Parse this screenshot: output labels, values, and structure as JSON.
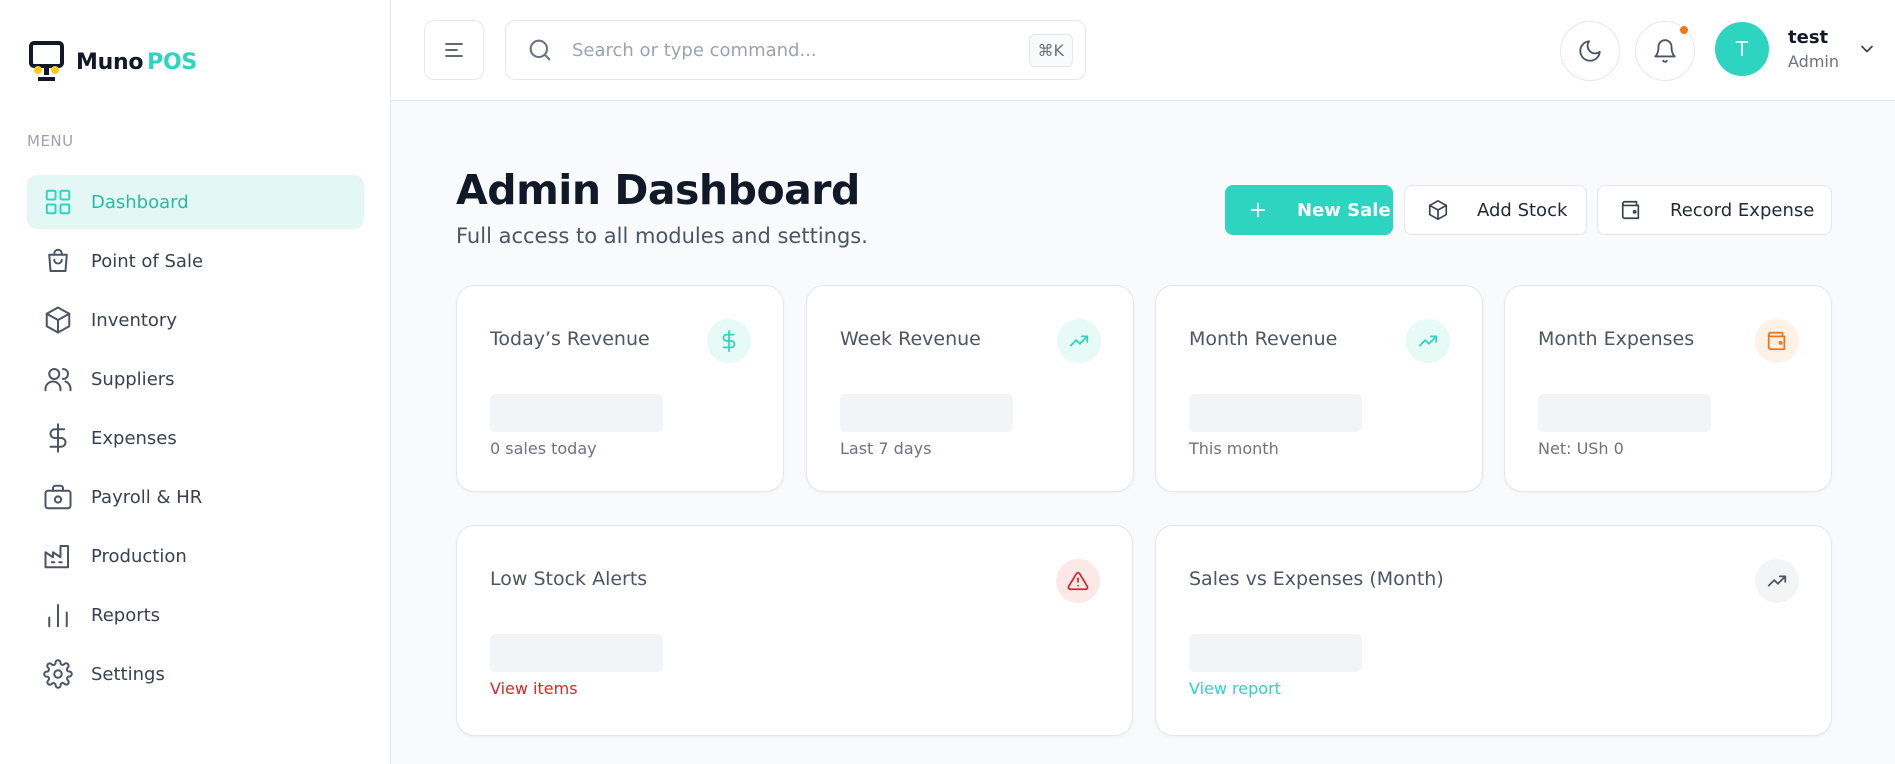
{
  "brand": {
    "name": "Muno",
    "accent": "POS"
  },
  "sidebar": {
    "menu_label": "MENU",
    "items": [
      {
        "label": "Dashboard",
        "icon": "grid-icon",
        "active": true
      },
      {
        "label": "Point of Sale",
        "icon": "shopping-bag-icon"
      },
      {
        "label": "Inventory",
        "icon": "box-icon"
      },
      {
        "label": "Suppliers",
        "icon": "users-icon"
      },
      {
        "label": "Expenses",
        "icon": "dollar-icon"
      },
      {
        "label": "Payroll & HR",
        "icon": "briefcase-icon"
      },
      {
        "label": "Production",
        "icon": "factory-icon"
      },
      {
        "label": "Reports",
        "icon": "bar-chart-icon"
      },
      {
        "label": "Settings",
        "icon": "gear-icon"
      }
    ]
  },
  "topbar": {
    "search_placeholder": "Search or type command...",
    "shortcut": "⌘K",
    "user": {
      "initial": "T",
      "name": "test",
      "role": "Admin"
    }
  },
  "page": {
    "title": "Admin Dashboard",
    "subtitle": "Full access to all modules and settings.",
    "actions": {
      "new_sale": "New Sale",
      "add_stock": "Add Stock",
      "record_expense": "Record Expense"
    }
  },
  "stats": [
    {
      "title": "Today’s Revenue",
      "sub": "0 sales today",
      "icon": "dollar-icon"
    },
    {
      "title": "Week Revenue",
      "sub": "Last 7 days",
      "icon": "trending-up-icon"
    },
    {
      "title": "Month Revenue",
      "sub": "This month",
      "icon": "trending-up-icon"
    },
    {
      "title": "Month Expenses",
      "sub": "Net: USh 0",
      "icon": "wallet-icon"
    }
  ],
  "panels": {
    "low_stock": {
      "title": "Low Stock Alerts",
      "link": "View items",
      "icon": "alert-triangle-icon"
    },
    "sales_vs_expenses": {
      "title": "Sales vs Expenses (Month)",
      "link": "View report",
      "icon": "trending-up-icon"
    }
  },
  "colors": {
    "accent": "#2dd4bf",
    "alert": "#dc2626",
    "warning": "#f97316"
  }
}
